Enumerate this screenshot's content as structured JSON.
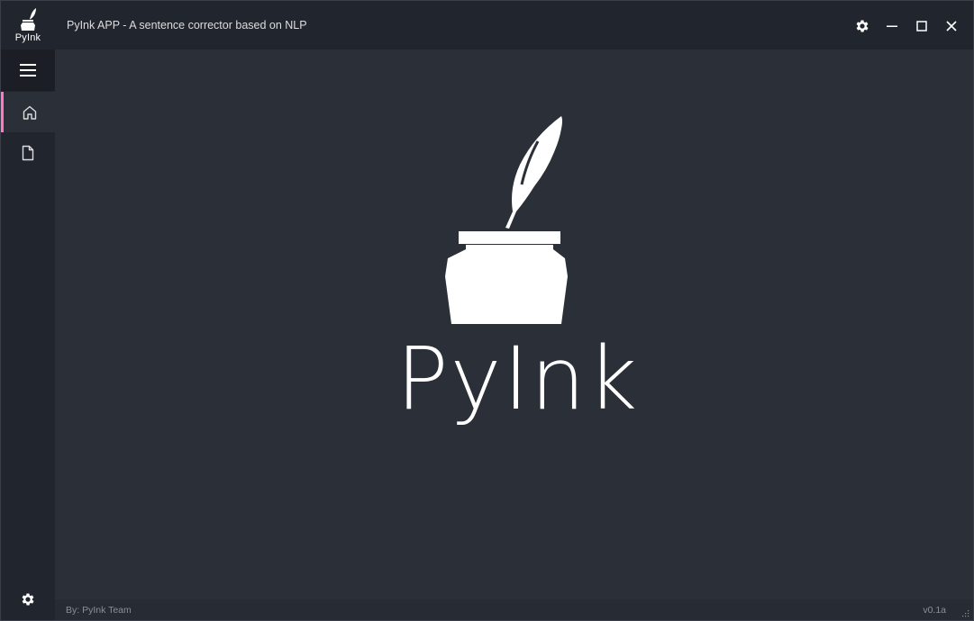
{
  "app": {
    "logo_text": "PyInk",
    "title": "PyInk APP - A sentence corrector based on NLP",
    "accent_color": "#ff79c6"
  },
  "left_menu": {
    "items": [
      {
        "name": "home",
        "icon": "home-icon",
        "active": true
      },
      {
        "name": "file",
        "icon": "file-icon",
        "active": false
      }
    ],
    "toggle_icon": "hamburger-icon",
    "bottom_icon": "gear-icon"
  },
  "title_bar": {
    "buttons": [
      "gear-icon",
      "minimize-icon",
      "maximize-icon",
      "close-icon"
    ]
  },
  "main": {
    "hero_title": "PyInk"
  },
  "footer": {
    "credits": "By: PyInk Team",
    "version": "v0.1a"
  }
}
